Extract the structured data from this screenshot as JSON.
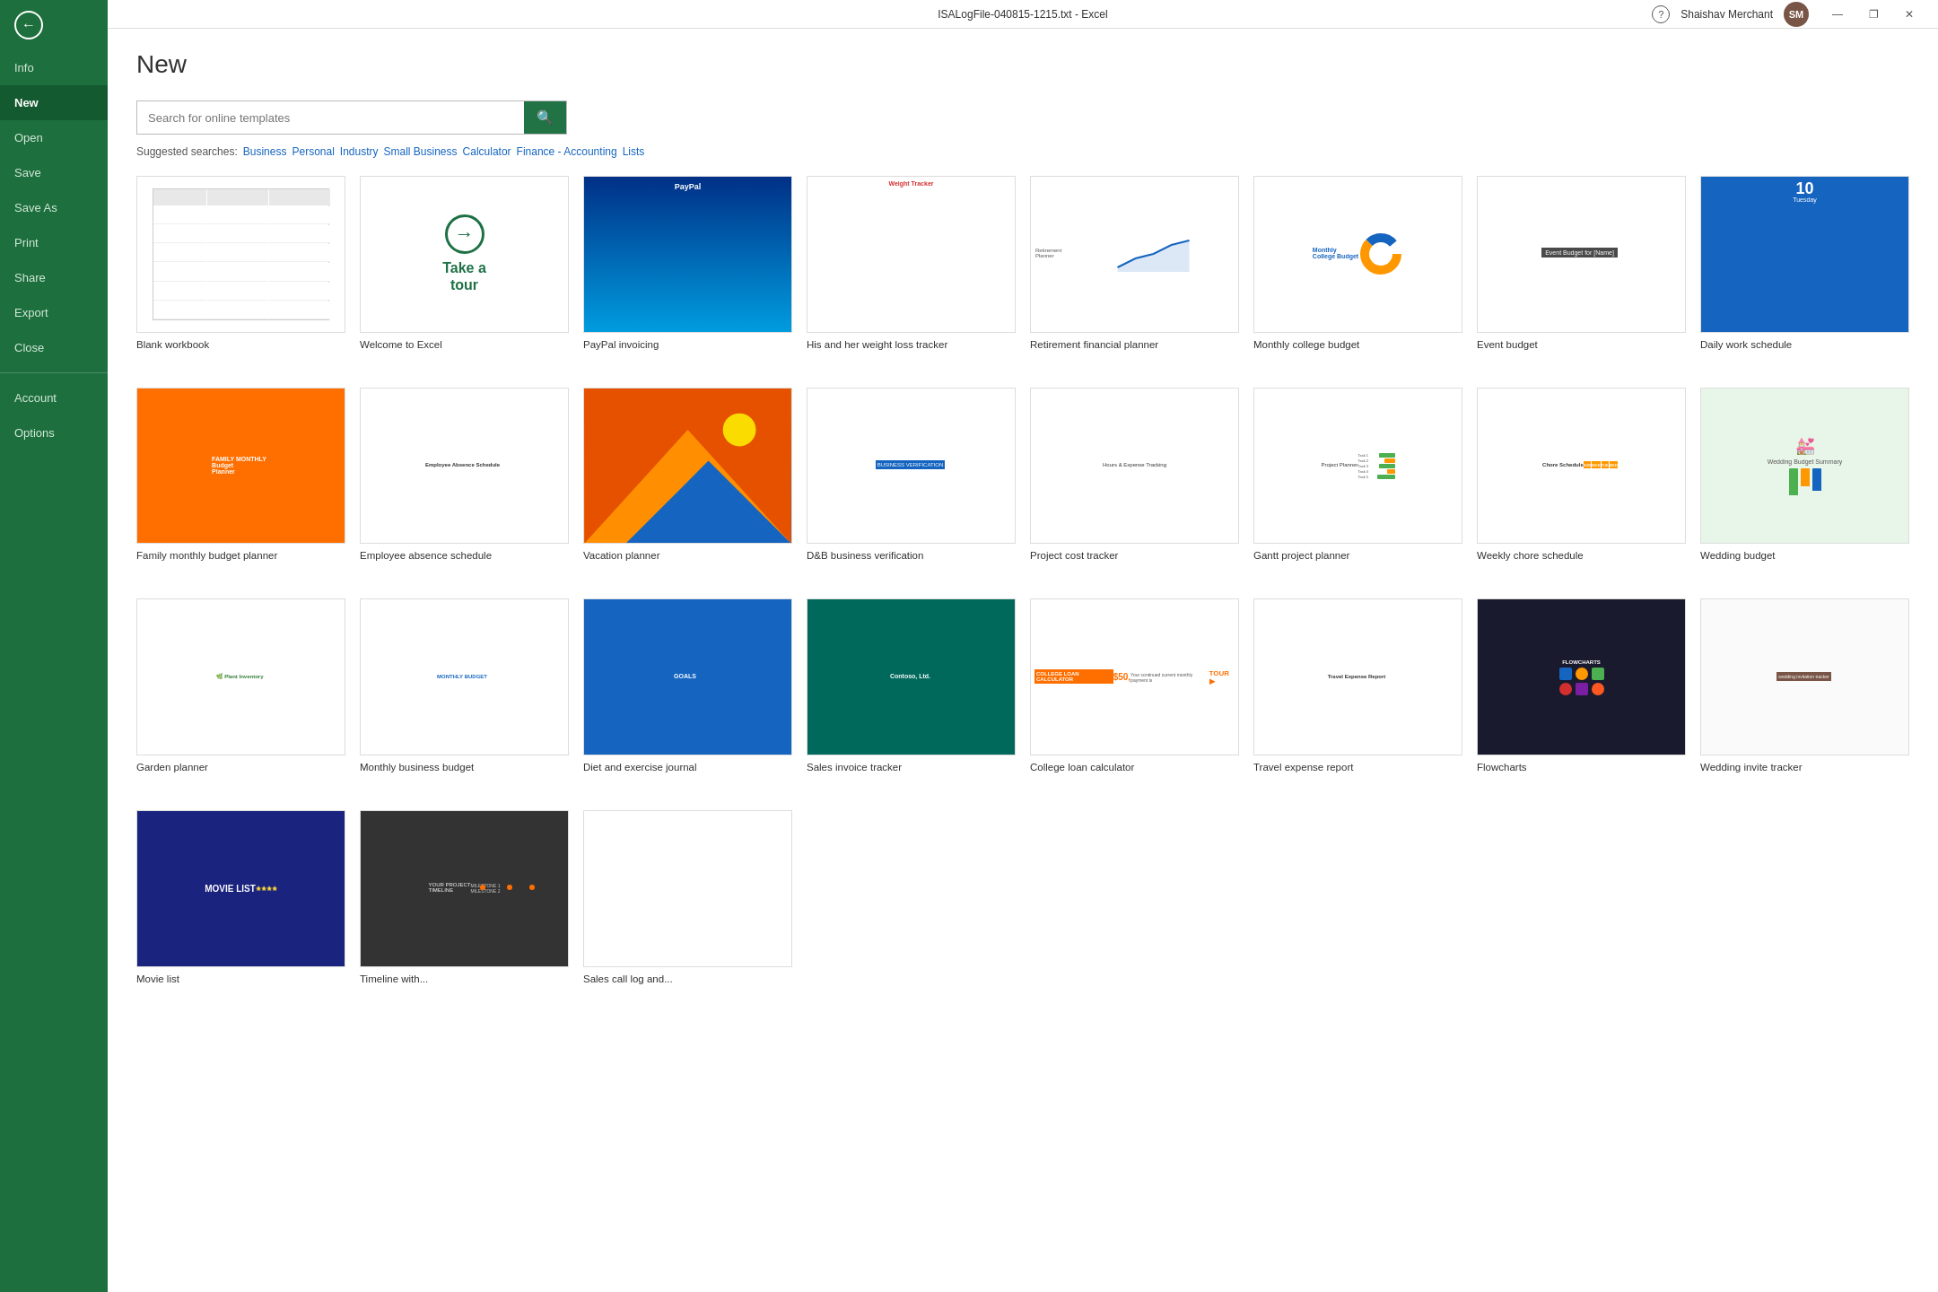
{
  "titlebar": {
    "title": "ISALogFile-040815-1215.txt - Excel",
    "user": "Shaishav Merchant",
    "buttons": {
      "minimize": "—",
      "restore": "❐",
      "close": "✕",
      "help": "?"
    }
  },
  "sidebar": {
    "back_label": "←",
    "items": [
      {
        "id": "info",
        "label": "Info",
        "active": false
      },
      {
        "id": "new",
        "label": "New",
        "active": true
      },
      {
        "id": "open",
        "label": "Open",
        "active": false
      },
      {
        "id": "save",
        "label": "Save",
        "active": false
      },
      {
        "id": "save-as",
        "label": "Save As",
        "active": false
      },
      {
        "id": "print",
        "label": "Print",
        "active": false
      },
      {
        "id": "share",
        "label": "Share",
        "active": false
      },
      {
        "id": "export",
        "label": "Export",
        "active": false
      },
      {
        "id": "close",
        "label": "Close",
        "active": false
      },
      {
        "id": "account",
        "label": "Account",
        "active": false
      },
      {
        "id": "options",
        "label": "Options",
        "active": false
      }
    ]
  },
  "main": {
    "page_title": "New",
    "search_placeholder": "Search for online templates",
    "search_button": "🔍",
    "suggested_label": "Suggested searches:",
    "suggested_links": [
      "Business",
      "Personal",
      "Industry",
      "Small Business",
      "Calculator",
      "Finance - Accounting",
      "Lists"
    ],
    "templates_row1": [
      {
        "id": "blank",
        "name": "Blank workbook"
      },
      {
        "id": "tour",
        "name": "Welcome to Excel"
      },
      {
        "id": "paypal",
        "name": "PayPal invoicing"
      },
      {
        "id": "weight",
        "name": "His and her weight loss tracker"
      },
      {
        "id": "retirement",
        "name": "Retirement financial planner"
      },
      {
        "id": "college-budget",
        "name": "Monthly college budget"
      },
      {
        "id": "event-budget",
        "name": "Event budget"
      },
      {
        "id": "daily-schedule",
        "name": "Daily work schedule"
      }
    ],
    "templates_row2": [
      {
        "id": "family-budget",
        "name": "Family monthly budget planner"
      },
      {
        "id": "employee-absence",
        "name": "Employee absence schedule"
      },
      {
        "id": "vacation",
        "name": "Vacation planner"
      },
      {
        "id": "db-business",
        "name": "D&B business verification"
      },
      {
        "id": "project-cost",
        "name": "Project cost tracker"
      },
      {
        "id": "gantt",
        "name": "Gantt project planner"
      },
      {
        "id": "chore-schedule",
        "name": "Weekly chore schedule"
      },
      {
        "id": "wedding-budget",
        "name": "Wedding budget"
      }
    ],
    "templates_row3": [
      {
        "id": "garden",
        "name": "Garden planner"
      },
      {
        "id": "monthly-biz",
        "name": "Monthly business budget"
      },
      {
        "id": "diet",
        "name": "Diet and exercise journal"
      },
      {
        "id": "sales-invoice",
        "name": "Sales invoice tracker"
      },
      {
        "id": "college-loan",
        "name": "College loan calculator"
      },
      {
        "id": "travel-expense",
        "name": "Travel expense report"
      },
      {
        "id": "flowcharts",
        "name": "Flowcharts"
      },
      {
        "id": "wedding-invite",
        "name": "Wedding invite tracker"
      }
    ],
    "templates_row4": [
      {
        "id": "movie-list",
        "name": "Movie list"
      },
      {
        "id": "timeline",
        "name": "Timeline with..."
      },
      {
        "id": "sales-call",
        "name": "Sales call log and..."
      }
    ]
  }
}
